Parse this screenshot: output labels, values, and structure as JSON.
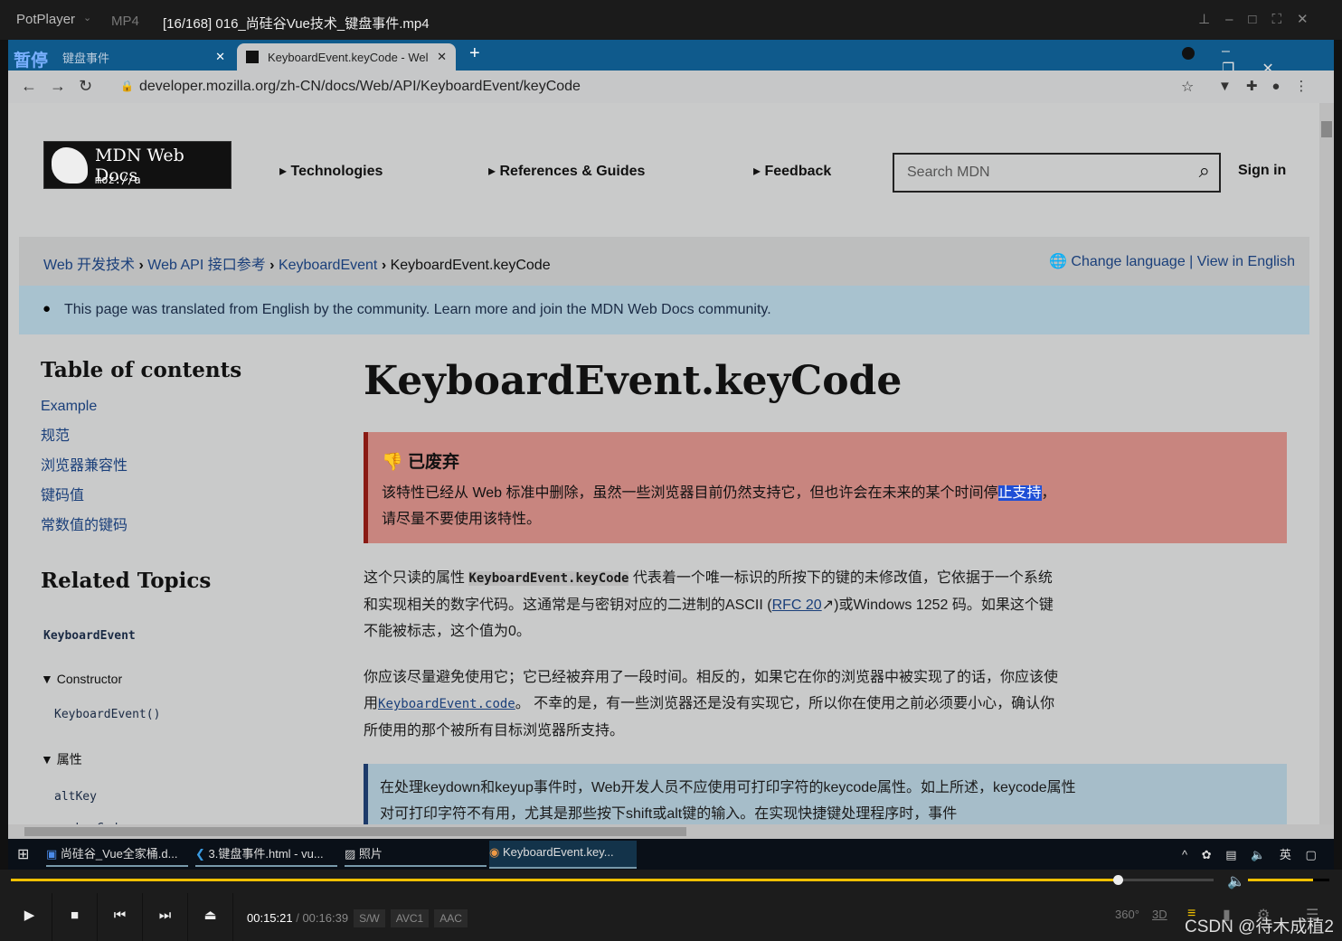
{
  "player": {
    "app": "PotPlayer",
    "format": "MP4",
    "title": "[16/168] 016_尚硅谷Vue技术_键盘事件.mp4",
    "paused_overlay": "暂停",
    "time_current": "00:15:21",
    "time_total": "00:16:39",
    "badges": [
      "S/W",
      "AVC1",
      "AAC"
    ],
    "progress": 0.92,
    "volume": 0.8,
    "right_icons": [
      "360°",
      "3D"
    ],
    "watermark": "CSDN @待木成植2",
    "accent": "#f0c000"
  },
  "browser": {
    "tabs": [
      {
        "label": "键盘事件",
        "active": false
      },
      {
        "label": "KeyboardEvent.keyCode - Wel",
        "active": true
      }
    ],
    "url": "developer.mozilla.org/zh-CN/docs/Web/API/KeyboardEvent/keyCode"
  },
  "mdn": {
    "logo_text": "MDN Web Docs",
    "logo_sub": "moz://a",
    "nav": [
      "Technologies",
      "References & Guides",
      "Feedback"
    ],
    "search_placeholder": "Search MDN",
    "sign_in": "Sign in",
    "breadcrumb": [
      "Web 开发技术",
      "Web API 接口参考",
      "KeyboardEvent",
      "KeyboardEvent.keyCode"
    ],
    "change_language": "Change language",
    "view_english": "View in English",
    "banner": "This page was translated from English by the community. Learn more and join the MDN Web Docs community.",
    "toc_title": "Table of contents",
    "toc": [
      "Example",
      "规范",
      "浏览器兼容性",
      "键码值",
      "常数值的键码"
    ],
    "related_title": "Related Topics",
    "related_root": "KeyboardEvent",
    "constructor_label": "Constructor",
    "constructor_item": "KeyboardEvent()",
    "props_label": "属性",
    "props_items": [
      "altKey",
      "charCode"
    ],
    "title": "KeyboardEvent.keyCode",
    "deprecated_title": "已废弃",
    "deprecated_text_a": "该特性已经从 Web 标准中删除，虽然一些浏览器目前仍然支持它，但也许会在未来的某个时间停",
    "deprecated_text_sel": "止支持",
    "deprecated_text_b": "，",
    "deprecated_text_c": "请尽量不要使用该特性。",
    "p1_a": "这个只读的属性 ",
    "p1_code": "KeyboardEvent.keyCode",
    "p1_b": " 代表着一个唯一标识的所按下的键的未修改值，它依据于一个系统和实现相关的数字代码。这通常是与密钥对应的二进制的ASCII (",
    "p1_link": "RFC 20",
    "p1_c": ")或Windows 1252 码。如果这个键不能被标志，这个值为0。",
    "p2_a": "你应该尽量避免使用它；它已经被弃用了一段时间。相反的，如果它在你的浏览器中被实现了的话，你应该使用",
    "p2_link": "KeyboardEvent.code",
    "p2_b": "。 不幸的是，有一些浏览器还是没有实现它，所以你在使用之前必须要小心，确认你所使用的那个被所有目标浏览器所支持。",
    "note": "在处理keydown和keyup事件时，Web开发人员不应使用可打印字符的keycode属性。如上所述，keycode属性对可打印字符不有用，尤其是那些按下shift或alt键的输入。在实现快捷键处理程序时，事件"
  },
  "taskbar": {
    "items": [
      "尚硅谷_Vue全家桶.d...",
      "3.键盘事件.html - vu...",
      "照片",
      "KeyboardEvent.key..."
    ],
    "ime": "英"
  }
}
